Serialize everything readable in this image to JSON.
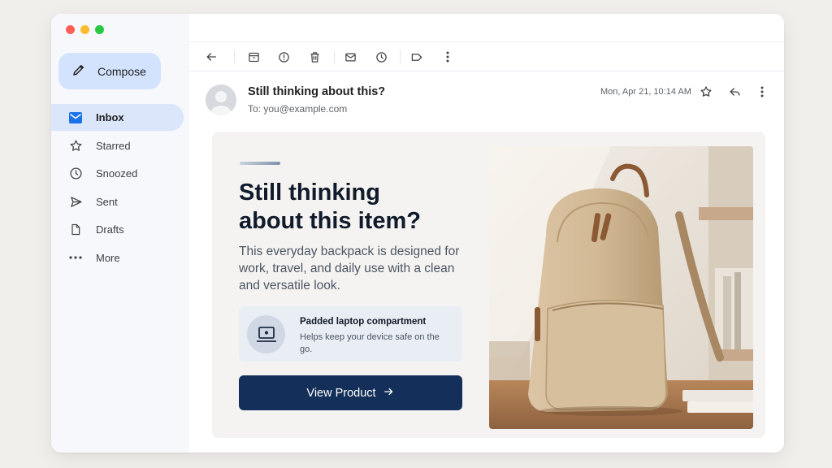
{
  "sidebar": {
    "compose_label": "Compose",
    "items": [
      {
        "label": "Inbox",
        "icon": "inbox-icon",
        "active": true
      },
      {
        "label": "Starred",
        "icon": "star-icon"
      },
      {
        "label": "Snoozed",
        "icon": "clock-icon"
      },
      {
        "label": "Sent",
        "icon": "send-icon"
      },
      {
        "label": "Drafts",
        "icon": "draft-icon"
      },
      {
        "label": "More",
        "icon": "more-horizontal-icon"
      }
    ]
  },
  "toolbar": {
    "icons": [
      "back-arrow-icon",
      "archive-icon",
      "report-spam-icon",
      "trash-icon",
      "mark-unread-icon",
      "snooze-icon",
      "label-icon",
      "more-vertical-icon"
    ]
  },
  "email": {
    "subject": "Still thinking about this?",
    "to": "To: you@example.com",
    "date": "Mon, Apr 21, 10:14 AM"
  },
  "content": {
    "headline_line1": "Still thinking",
    "headline_line2": "about this item?",
    "body": "This everyday backpack is designed for work, travel, and daily use with a clean and versatile look.",
    "feature": {
      "title": "Padded laptop compartment",
      "desc": "Helps keep your device safe on the go.",
      "icon": "laptop-icon"
    },
    "cta_label": "View Product",
    "cta_icon": "arrow-right-icon"
  },
  "colors": {
    "accent": "#14305a",
    "compose_bg": "#d3e3fd",
    "inbox_icon": "#1a73e8"
  }
}
